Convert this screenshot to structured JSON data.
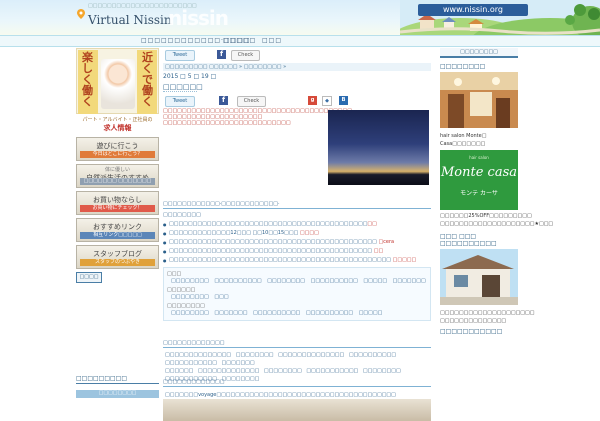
{
  "header": {
    "tagline": "□□□□□□□□□□□□□□□□□□□□□□□",
    "site_name": "Virtual Nissin",
    "ghost_text": "nissin",
    "url": "www.nissin.org"
  },
  "nav": {
    "items": [
      "□□□□□□□□□□□□·□□□□",
      "□□□□□",
      "□□□"
    ]
  },
  "left": {
    "promo": {
      "left_text": "楽しく働く",
      "right_text": "近くで働く",
      "caption": "パート・アルバイト・正社員の",
      "job": "求人情報"
    },
    "buttons": [
      {
        "title": "遊びに行こう",
        "sub": "今日はどこに行こう？",
        "sub_color": "#e07b3a"
      },
      {
        "title": "自然派生活のすすめ",
        "sub": "□□□□□□□ □□□□□□□",
        "sub_color": "#8f9fb0",
        "top": "体に優しい"
      },
      {
        "title": "お買い物ならし",
        "sub": "お買い物にチェック！",
        "sub_color": "#e05a4a"
      },
      {
        "title": "おすすめリンク",
        "sub": "相互リンク□□□□□",
        "sub_color": "#5b86b8"
      },
      {
        "title": "スタッフブログ",
        "sub": "スタッフのつぶやき",
        "sub_color": "#e0a13a"
      }
    ],
    "tag": "□□□□",
    "bottom_title": "□□□□□□□□□",
    "bottom_banner": "□□□□□□□□"
  },
  "main": {
    "share": {
      "tweet": "Tweet",
      "check": "Check"
    },
    "breadcrumb": "□□□□□□□□□ □□□□□□ » □□□□□□□□ »",
    "date": "2015 □ 5 □ 19 □",
    "post_title": "□□□□□□",
    "share2": {
      "tweet": "Tweet",
      "check": "Check"
    },
    "red_lines": [
      "□□□□□□□□□□□□□□□□□□□□□□□□□□□□□□□□□□□□□□□□",
      "□□□□□□□□□□□□□□□□□□□□□",
      "□□□□□□□□□□□□□□□□□□□□□□□□□□□"
    ],
    "related_heading": "□□□□□□□□□□□□·□□□□□□□□□□□□·",
    "related_sub": "□□□□□□□□",
    "related_items": [
      {
        "text": "□□□□□□□□□□□□□□□□□□□□□□□□□□□□□□□□□□□□□□□□□□",
        "tail": "□□"
      },
      {
        "text": "□□□□□□□□□□□□□12□□□ □□10□□15□□□ ",
        "tail": "□□□□"
      },
      {
        "text": "□□□□□□□□□□□□□□□□□□□□□□□□□□□□□□□□□□□□□□□□□□□□ ",
        "tail": "□cera"
      },
      {
        "text": "□□□□□□□□□□□□□□□□□□□□□□□□□□□□□□□□□□□□□□□□□□□ ",
        "tail": "□□"
      },
      {
        "text": "□□□□□□□□□□□□□□□□□□□□□□□□□□□□□□□□□□□□□□□□□□□□□□□ ",
        "tail": "□□□□□"
      }
    ],
    "tag_groups": [
      {
        "label": "□□□",
        "items": "□□□□□□□□ □□□□□□□□□□ □□□□□□□□ □□□□□□□□□□ □□□□□ □□□□□□□"
      },
      {
        "label": "□□□□□□",
        "items": "□□□□□□□□ □□□"
      },
      {
        "label": "□□□□□□□□",
        "items": "□□□□□□□□ □□□□□□□ □□□□□□□□□□ □□□□□□□□□□ □□□□□"
      }
    ],
    "section2_heading": "□□□□□□□□□□□□□",
    "section2_lines": [
      "□□□□□□□□□□□□□□ □□□□□□□□ □□□□□□□□□□□□□□ □□□□□□□□□□ □□□□□□□□□□□ □□□□□□□",
      "□□□□□□ □□□□□□□□□□□□□ □□□□□□□□ □□□□□□□□□□□ □□□□□□□□ □□□□□□□□□□□ □□□□□□□□"
    ],
    "section3_heading": "□□□□□□□□□□□□□",
    "section3_line": "□□□□□□□voyage□□□□□□□□□□□□□□□□□□□□□□□□□□□□□□□□□□□□□□"
  },
  "right": {
    "tag": "□□□□□□□□",
    "shop1_title": "□□□□□□□□",
    "shop2_text": [
      "hair salon Monte□",
      "Casa□□□□□□□"
    ],
    "shop2_promo": [
      "□□□□□□25%OFF□□□□□□□□□",
      "□□□□□□□□□□□□□□□□□□□□★□□□"
    ],
    "shop3_title": "□□□ □□□ □□□□□□□□□□",
    "shop3_text": [
      "□□□□□□□□□□□□□□□□□□□□",
      "□□□□□□□□□□□□□□"
    ],
    "shop4_title": "□□□□□□□□□□□"
  },
  "colors": {
    "brand_blue": "#2a5f8a",
    "accent_red": "#c0302a",
    "monte_green": "#2f9a3e"
  }
}
